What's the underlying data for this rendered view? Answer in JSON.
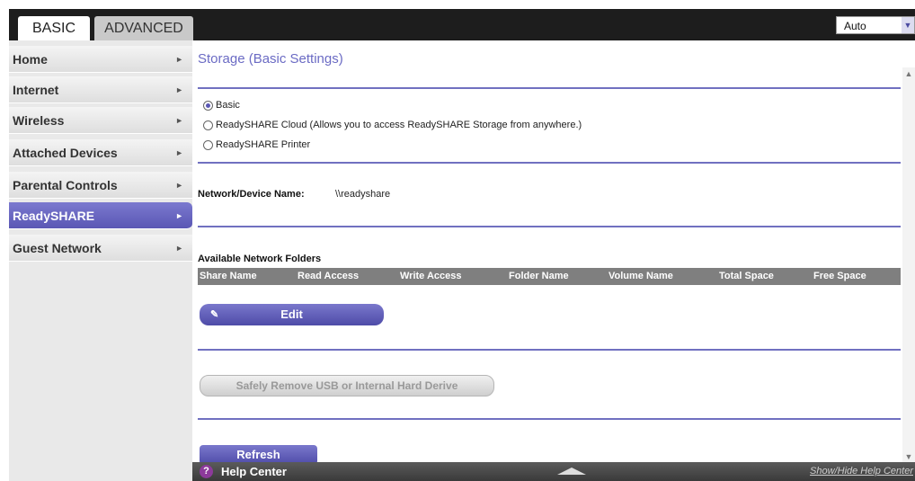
{
  "tabs": {
    "basic": "BASIC",
    "advanced": "ADVANCED"
  },
  "language": {
    "selected": "Auto"
  },
  "sidebar": {
    "items": [
      {
        "label": "Home"
      },
      {
        "label": "Internet"
      },
      {
        "label": "Wireless"
      },
      {
        "label": "Attached Devices"
      },
      {
        "label": "Parental Controls"
      },
      {
        "label": "ReadySHARE",
        "active": true
      },
      {
        "label": "Guest Network"
      }
    ]
  },
  "main": {
    "title": "Storage (Basic Settings)",
    "radios": [
      {
        "label": "Basic",
        "checked": true
      },
      {
        "label": "ReadySHARE Cloud (Allows you to access ReadySHARE Storage from anywhere.)",
        "checked": false
      },
      {
        "label": "ReadySHARE Printer",
        "checked": false
      }
    ],
    "device_name_label": "Network/Device Name:",
    "device_name_value": "\\\\readyshare",
    "folders_label": "Available Network Folders",
    "columns": [
      "Share Name",
      "Read Access",
      "Write Access",
      "Folder Name",
      "Volume Name",
      "Total Space",
      "Free Space"
    ],
    "edit_label": "Edit",
    "remove_label": "Safely Remove USB or Internal Hard Derive",
    "refresh_label": "Refresh"
  },
  "help": {
    "label": "Help Center",
    "toggle_link": "Show/Hide Help Center"
  },
  "colors": {
    "accent": "#5a57b4",
    "title": "#6b6bc4"
  }
}
